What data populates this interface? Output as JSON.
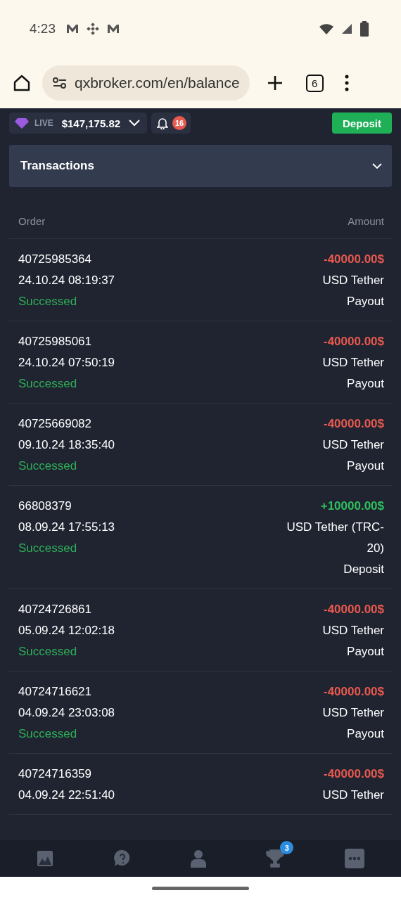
{
  "status_bar": {
    "time": "4:23"
  },
  "browser": {
    "url": "qxbroker.com/en/balance",
    "tab_count": "6"
  },
  "header": {
    "account_type": "LIVE",
    "balance": "$147,175.82",
    "notifications": "16",
    "deposit_button": "Deposit"
  },
  "panel": {
    "title": "Transactions",
    "expanded": false
  },
  "table": {
    "columns": [
      "Order",
      "Amount"
    ],
    "rows": [
      {
        "order": "40725985364",
        "date": "24.10.24 08:19:37",
        "status": "Successed",
        "amount": "-40000.00$",
        "method": "USD Tether",
        "type": "Payout",
        "kind": "payout"
      },
      {
        "order": "40725985061",
        "date": "24.10.24 07:50:19",
        "status": "Successed",
        "amount": "-40000.00$",
        "method": "USD Tether",
        "type": "Payout",
        "kind": "payout"
      },
      {
        "order": "40725669082",
        "date": "09.10.24 18:35:40",
        "status": "Successed",
        "amount": "-40000.00$",
        "method": "USD Tether",
        "type": "Payout",
        "kind": "payout"
      },
      {
        "order": "66808379",
        "date": "08.09.24 17:55:13",
        "status": "Successed",
        "amount": "+10000.00$",
        "method": "USD Tether (TRC-20)",
        "type": "Deposit",
        "kind": "deposit"
      },
      {
        "order": "40724726861",
        "date": "05.09.24 12:02:18",
        "status": "Successed",
        "amount": "-40000.00$",
        "method": "USD Tether",
        "type": "Payout",
        "kind": "payout"
      },
      {
        "order": "40724716621",
        "date": "04.09.24 23:03:08",
        "status": "Successed",
        "amount": "-40000.00$",
        "method": "USD Tether",
        "type": "Payout",
        "kind": "payout"
      },
      {
        "order": "40724716359",
        "date": "04.09.24 22:51:40",
        "amount": "-40000.00$",
        "method": "USD Tether",
        "kind": "payout"
      }
    ]
  },
  "bottom_nav": {
    "trophy_badge": "3"
  }
}
